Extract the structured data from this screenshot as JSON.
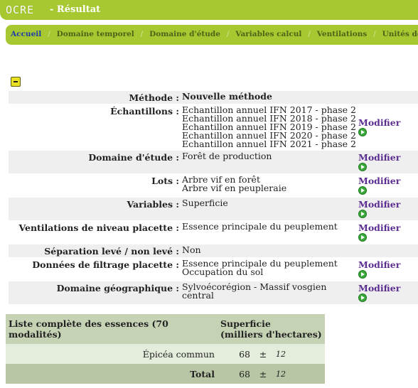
{
  "header": {
    "logo": "OCRE",
    "title": "- Résultat"
  },
  "nav": {
    "items": [
      "Accueil",
      "Domaine temporel",
      "Domaine d'étude",
      "Variables calcul",
      "Ventilations",
      "Unités de vent"
    ]
  },
  "params": {
    "modify_label": "Modifier",
    "methode": {
      "label": "Méthode :",
      "value": "Nouvelle méthode"
    },
    "echantillons": {
      "label": "Échantillons :",
      "values": [
        "Echantillon annuel IFN 2017 - phase 2",
        "Echantillon annuel IFN 2018 - phase 2",
        "Echantillon annuel IFN 2019 - phase 2",
        "Echantillon annuel IFN 2020 - phase 2",
        "Echantillon annuel IFN 2021 - phase 2"
      ]
    },
    "domaine_etude": {
      "label": "Domaine d'étude :",
      "value": "Forêt de production"
    },
    "lots": {
      "label": "Lots :",
      "values": [
        "Arbre vif en forêt",
        "Arbre vif en peupleraie"
      ]
    },
    "variables": {
      "label": "Variables :",
      "value": "Superficie"
    },
    "ventilations": {
      "label": "Ventilations de niveau placette :",
      "value": "Essence principale du peuplement"
    },
    "separation": {
      "label": "Séparation levé / non levé :",
      "value": "Non"
    },
    "filtrage": {
      "label": "Données de filtrage placette :",
      "values": [
        "Essence principale du peuplement",
        "Occupation du sol"
      ]
    },
    "geographique": {
      "label": "Domaine géographique :",
      "value": "Sylvoécorégion - Massif vosgien central"
    }
  },
  "results": {
    "col1": "Liste complète des essences (70 modalités)",
    "col2_line1": "Superficie",
    "col2_line2": "(milliers d'hectares)",
    "rows": [
      {
        "label": "Épicéa commun",
        "value": "68",
        "pm": "±",
        "err": "12"
      }
    ],
    "total": {
      "label": "Total",
      "value": "68",
      "pm": "±",
      "err": "12"
    }
  },
  "colors": {
    "header_green": "#a8c832",
    "link_purple": "#5c2d91",
    "nav_active": "#1e3da6"
  }
}
